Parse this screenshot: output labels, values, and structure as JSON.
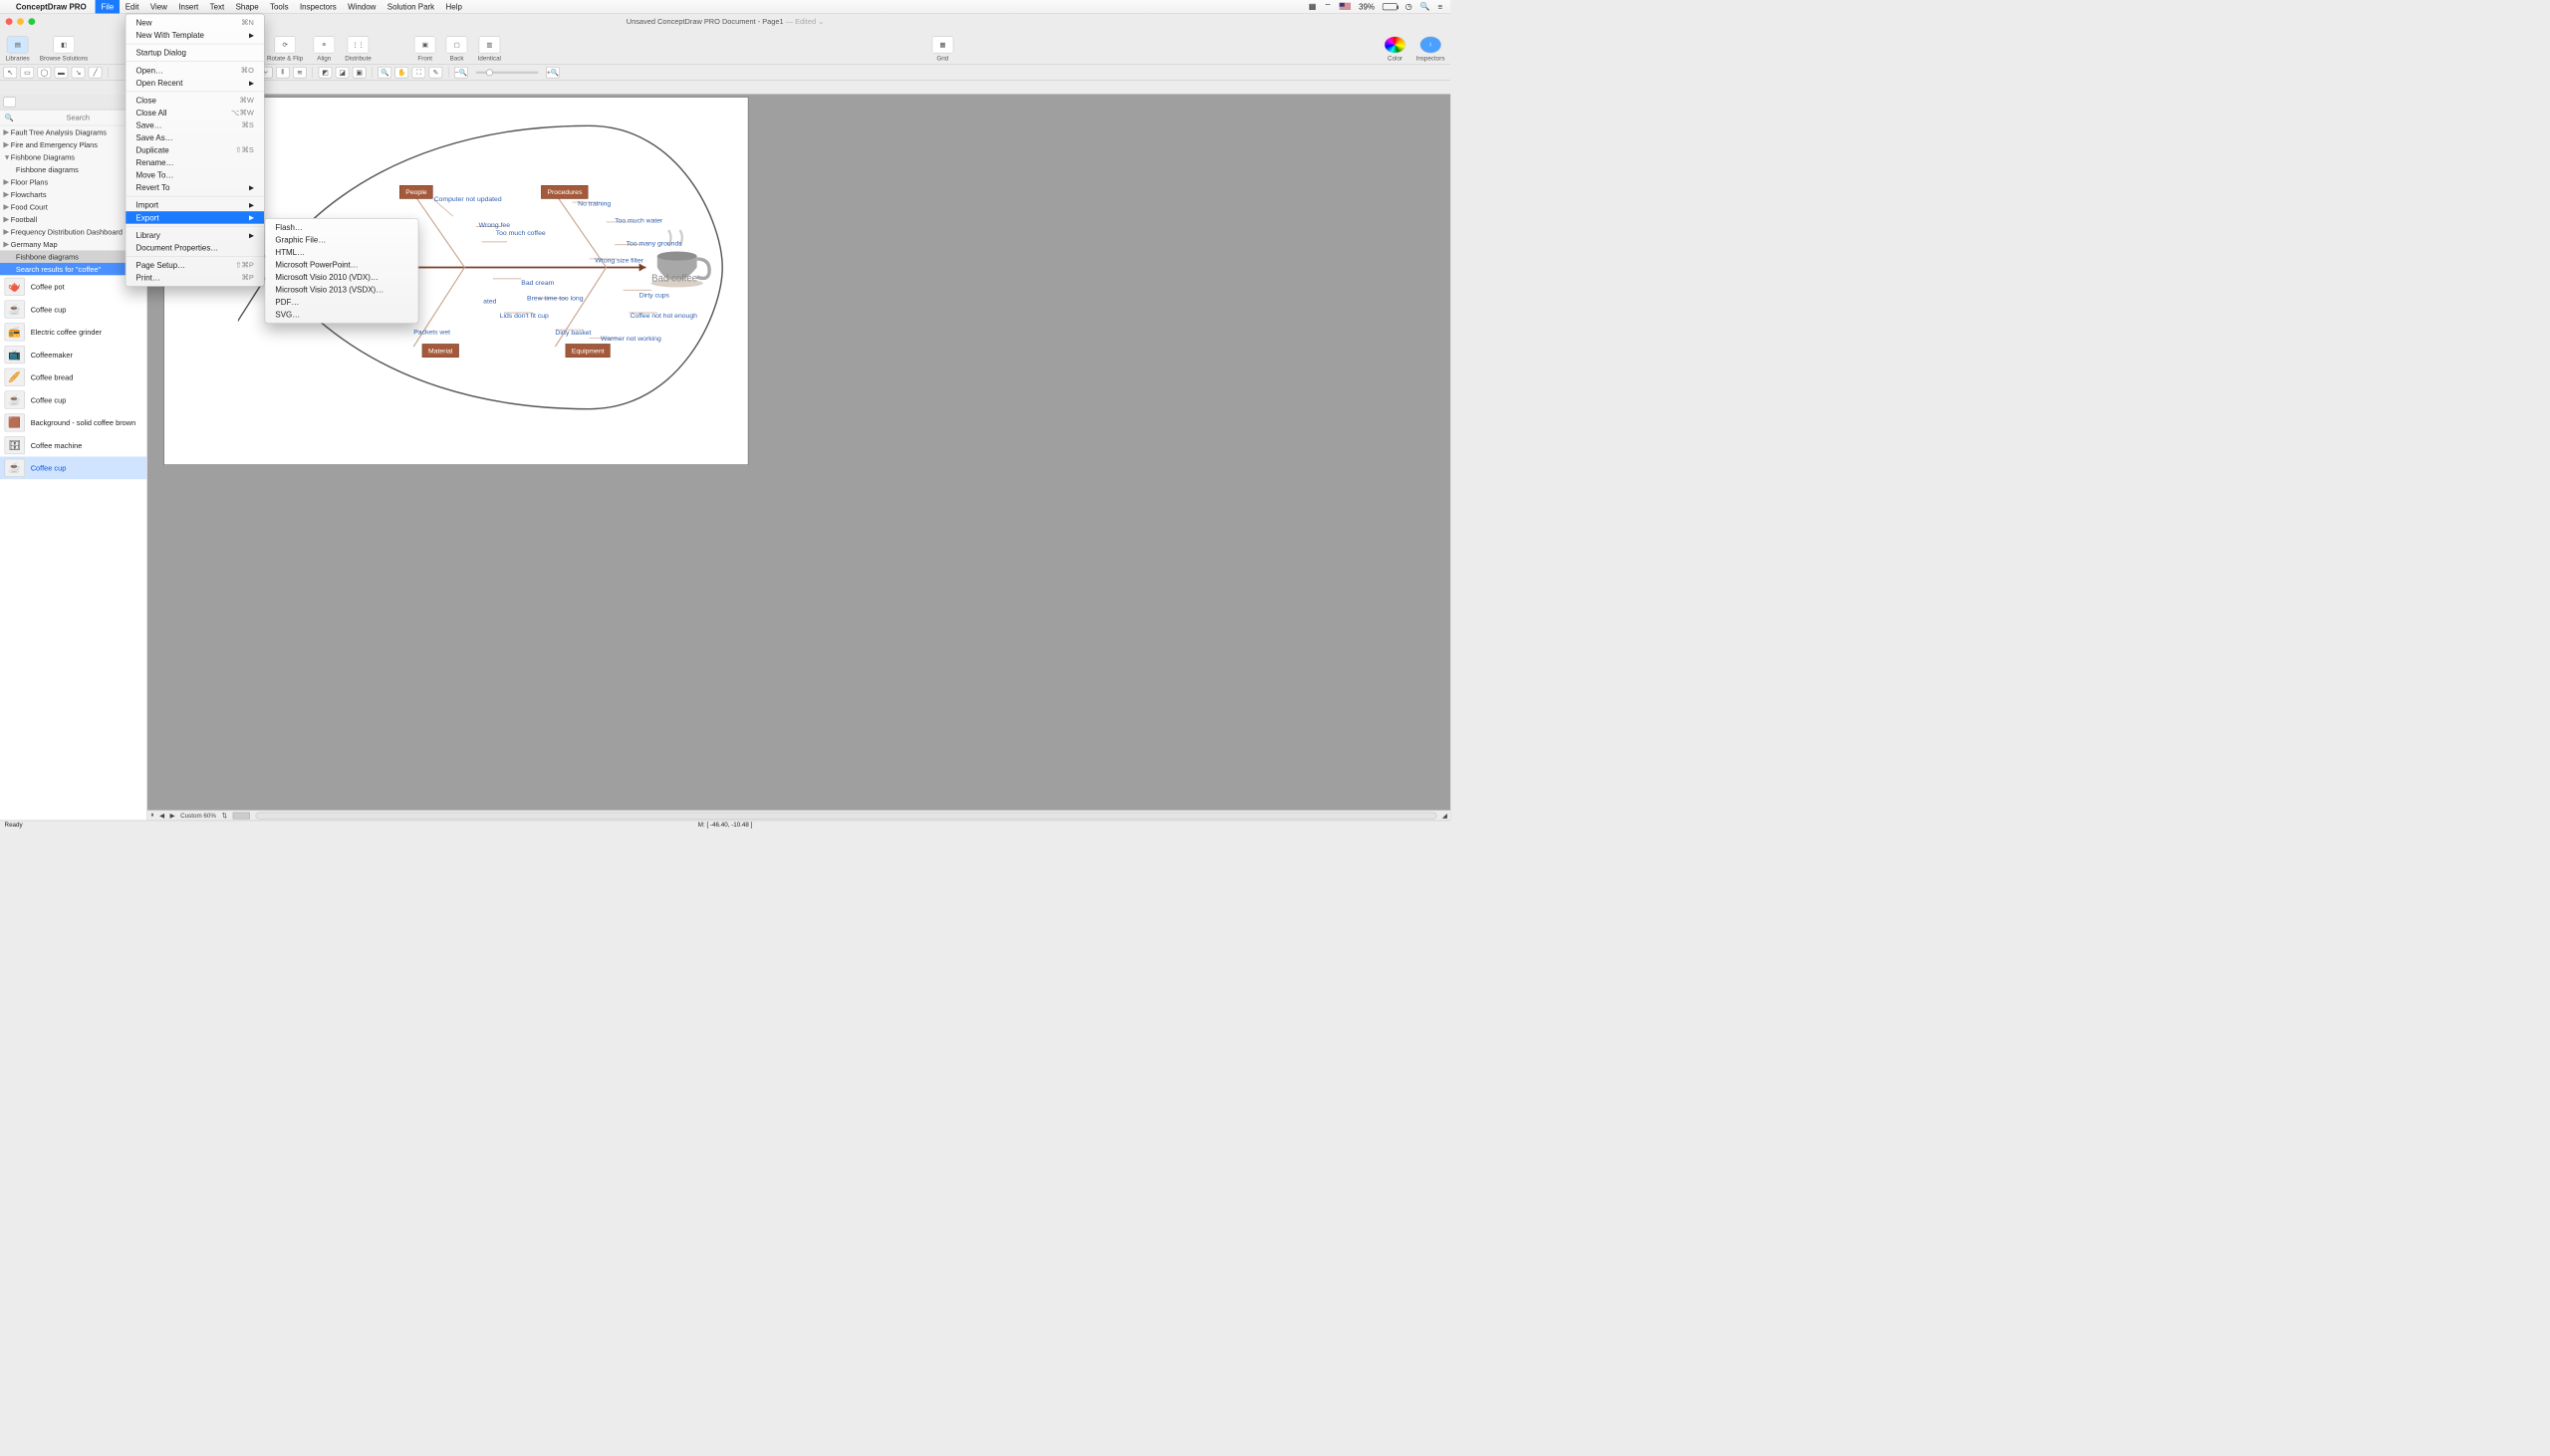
{
  "menubar": {
    "app": "ConceptDraw PRO",
    "items": [
      "File",
      "Edit",
      "View",
      "Insert",
      "Text",
      "Shape",
      "Tools",
      "Inspectors",
      "Window",
      "Solution Park",
      "Help"
    ],
    "active_index": 0,
    "battery_pct": "39%"
  },
  "window": {
    "title_main": "Unsaved ConceptDraw PRO Document - Page1",
    "title_suffix": " — Edited"
  },
  "toolbar": {
    "libraries": "Libraries",
    "browse": "Browse Solutions",
    "rotate": "Rotate & Flip",
    "align": "Align",
    "distribute": "Distribute",
    "front": "Front",
    "back": "Back",
    "identical": "Identical",
    "grid": "Grid",
    "color": "Color",
    "inspectors": "Inspectors"
  },
  "sidebar": {
    "search_placeholder": "Search",
    "tree": [
      {
        "label": "Fault Tree Analysis Diagrams",
        "expand": false
      },
      {
        "label": "Fire and Emergency Plans",
        "expand": false
      },
      {
        "label": "Fishbone Diagrams",
        "expand": true
      },
      {
        "label": "Fishbone diagrams",
        "child": true
      },
      {
        "label": "Floor Plans",
        "expand": false
      },
      {
        "label": "Flowcharts",
        "expand": false
      },
      {
        "label": "Food Court",
        "expand": false
      },
      {
        "label": "Football",
        "expand": false
      },
      {
        "label": "Frequency Distribution Dashboard",
        "expand": false
      },
      {
        "label": "Germany Map",
        "expand": false
      },
      {
        "label": "Fishbone diagrams",
        "child": true,
        "sel": true
      },
      {
        "label": "Search results for \"coffee\"",
        "child": true,
        "sel_blue": true
      }
    ],
    "items": [
      {
        "name": "Coffee pot",
        "icon": "🫖"
      },
      {
        "name": "Coffee cup",
        "icon": "☕"
      },
      {
        "name": "Electric coffee grinder",
        "icon": "📻"
      },
      {
        "name": "Coffeemaker",
        "icon": "📺"
      },
      {
        "name": "Coffee bread",
        "icon": "🥖"
      },
      {
        "name": "Coffee cup",
        "icon": "☕"
      },
      {
        "name": "Background - solid coffee brown",
        "icon": "🟫"
      },
      {
        "name": "Coffee machine",
        "icon": "🗄"
      },
      {
        "name": "Coffee cup",
        "icon": "☕",
        "sel": true
      }
    ]
  },
  "file_menu": [
    {
      "label": "New",
      "sc": "⌘N"
    },
    {
      "label": "New With Template",
      "sub": true
    },
    {
      "sep": true
    },
    {
      "label": "Startup Dialog"
    },
    {
      "sep": true
    },
    {
      "label": "Open…",
      "sc": "⌘O"
    },
    {
      "label": "Open Recent",
      "sub": true
    },
    {
      "sep": true
    },
    {
      "label": "Close",
      "sc": "⌘W"
    },
    {
      "label": "Close All",
      "sc": "⌥⌘W"
    },
    {
      "label": "Save…",
      "sc": "⌘S"
    },
    {
      "label": "Save As…"
    },
    {
      "label": "Duplicate",
      "sc": "⇧⌘S"
    },
    {
      "label": "Rename…"
    },
    {
      "label": "Move To…"
    },
    {
      "label": "Revert To",
      "sub": true
    },
    {
      "sep": true
    },
    {
      "label": "Import",
      "sub": true
    },
    {
      "label": "Export",
      "sub": true,
      "active": true
    },
    {
      "sep": true
    },
    {
      "label": "Library",
      "sub": true
    },
    {
      "label": "Document Properties…"
    },
    {
      "sep": true
    },
    {
      "label": "Page Setup…",
      "sc": "⇧⌘P"
    },
    {
      "label": "Print…",
      "sc": "⌘P"
    }
  ],
  "export_menu": [
    {
      "label": "Flash…"
    },
    {
      "label": "Graphic File…"
    },
    {
      "label": "HTML…"
    },
    {
      "label": "Microsoft PowerPoint…"
    },
    {
      "label": "Microsoft Visio 2010 (VDX)…"
    },
    {
      "label": "Microsoft Visio 2013 (VSDX)…"
    },
    {
      "label": "PDF…"
    },
    {
      "label": "SVG…"
    }
  ],
  "chart_data": {
    "type": "fishbone-diagram",
    "effect": "Bad coffee",
    "categories": [
      {
        "name": "People",
        "causes": [
          "Computer not updated",
          "Wrong fee",
          "Too much coffee"
        ]
      },
      {
        "name": "Procedures",
        "causes": [
          "No training",
          "Too much water",
          "Too many grounds",
          "Wrong size filter"
        ]
      },
      {
        "name": "Material",
        "causes": [
          "Bad cream",
          "Packets wet"
        ]
      },
      {
        "name": "Equipment",
        "causes": [
          "Brew time too long",
          "Lids don't fit cup",
          "Dirty basket",
          "Dirty cups",
          "Coffee not hot enough",
          "Warmer not working"
        ]
      }
    ]
  },
  "fish_labels": {
    "people": "People",
    "procedures": "Procedures",
    "material": "Material",
    "equipment": "Equipment",
    "effect": "Bad coffee",
    "c1": "Computer not\nupdated",
    "c2": "Wrong fee",
    "c3": "Too much\ncoffee",
    "c4": "No training",
    "c5": "Too much\nwater",
    "c6": "Too many\ngrounds",
    "c7": "Wrong size filter",
    "c8": "Bad cream",
    "c9": "Brew time too\nlong",
    "c10": "Lids don't fit\ncup",
    "c11": "Dirty cups",
    "c12": "Coffee not\nhot enough",
    "c13": "Packets wet",
    "c14": "Dirty basket",
    "c15": "Warmer not\nworking",
    "c16": "ated"
  },
  "canvas_bottom": {
    "zoom": "Custom 60%"
  },
  "status": {
    "ready": "Ready",
    "mouse": "M: [ -46.40, -10.48 ]"
  }
}
